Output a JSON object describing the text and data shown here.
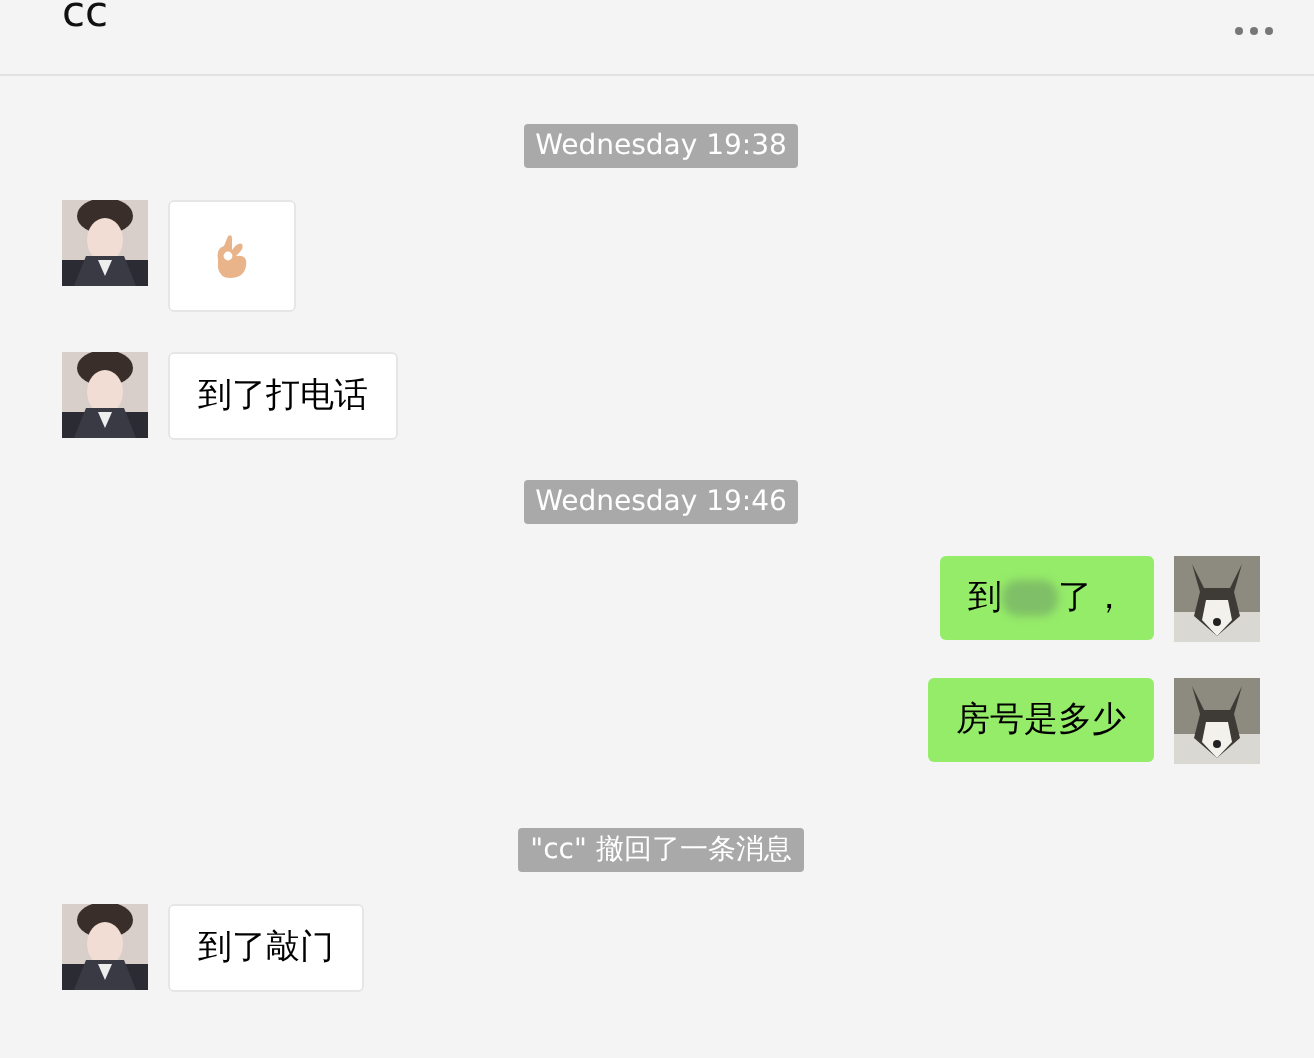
{
  "header": {
    "title": "cc"
  },
  "messages": [
    {
      "kind": "time",
      "text": "Wednesday 19:38"
    },
    {
      "kind": "incoming-emoji"
    },
    {
      "kind": "incoming-text",
      "text": "到了打电话"
    },
    {
      "kind": "time",
      "text": "Wednesday 19:46"
    },
    {
      "kind": "outgoing-redacted",
      "parts": [
        "到",
        "了，"
      ]
    },
    {
      "kind": "outgoing-text",
      "text": "房号是多少"
    },
    {
      "kind": "recall",
      "text": "\"cc\" 撤回了一条消息"
    },
    {
      "kind": "incoming-text",
      "text": "到了敲门"
    }
  ]
}
